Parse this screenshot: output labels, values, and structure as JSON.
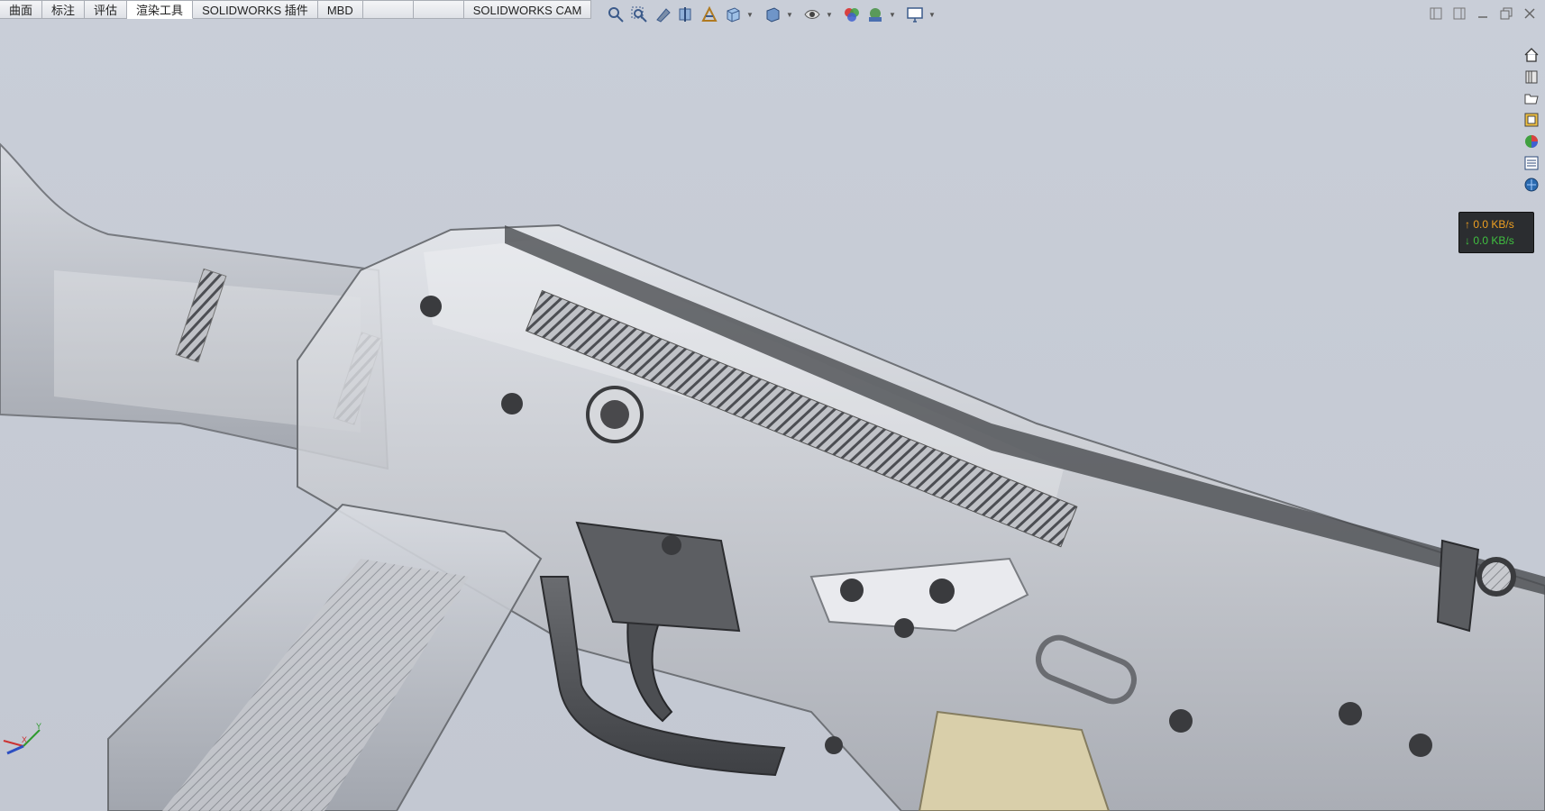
{
  "tabs": [
    {
      "label": "曲面",
      "active": false
    },
    {
      "label": "标注",
      "active": false
    },
    {
      "label": "评估",
      "active": false
    },
    {
      "label": "渲染工具",
      "active": true
    },
    {
      "label": "SOLIDWORKS 插件",
      "active": false
    },
    {
      "label": "MBD",
      "active": false
    },
    {
      "label": "",
      "active": false
    },
    {
      "label": "",
      "active": false
    },
    {
      "label": "SOLIDWORKS CAM",
      "active": false
    }
  ],
  "hud_icons": [
    "zoom-to-fit-icon",
    "zoom-to-area-icon",
    "previous-view-icon",
    "section-view-icon",
    "dynamic-annotation-icon",
    "view-orientation-icon",
    "display-style-icon",
    "hide-show-items-icon",
    "edit-appearance-icon",
    "apply-scene-icon",
    "view-settings-icon"
  ],
  "window_controls": [
    "tile-left-icon",
    "tile-right-icon",
    "minimize-icon",
    "restore-icon",
    "close-icon"
  ],
  "taskpane_icons": [
    "home-icon",
    "design-library-icon",
    "file-explorer-icon",
    "view-palette-icon",
    "appearances-icon",
    "custom-properties-icon",
    "solidworks-forum-icon"
  ],
  "net": {
    "up": "↑ 0.0 KB/s",
    "down": "↓ 0.0 KB/s"
  },
  "triad": {
    "x": "X",
    "y": "Y"
  },
  "colors": {
    "background": "#c6cbd5",
    "accent_up": "#f0a020",
    "accent_down": "#40c040"
  }
}
